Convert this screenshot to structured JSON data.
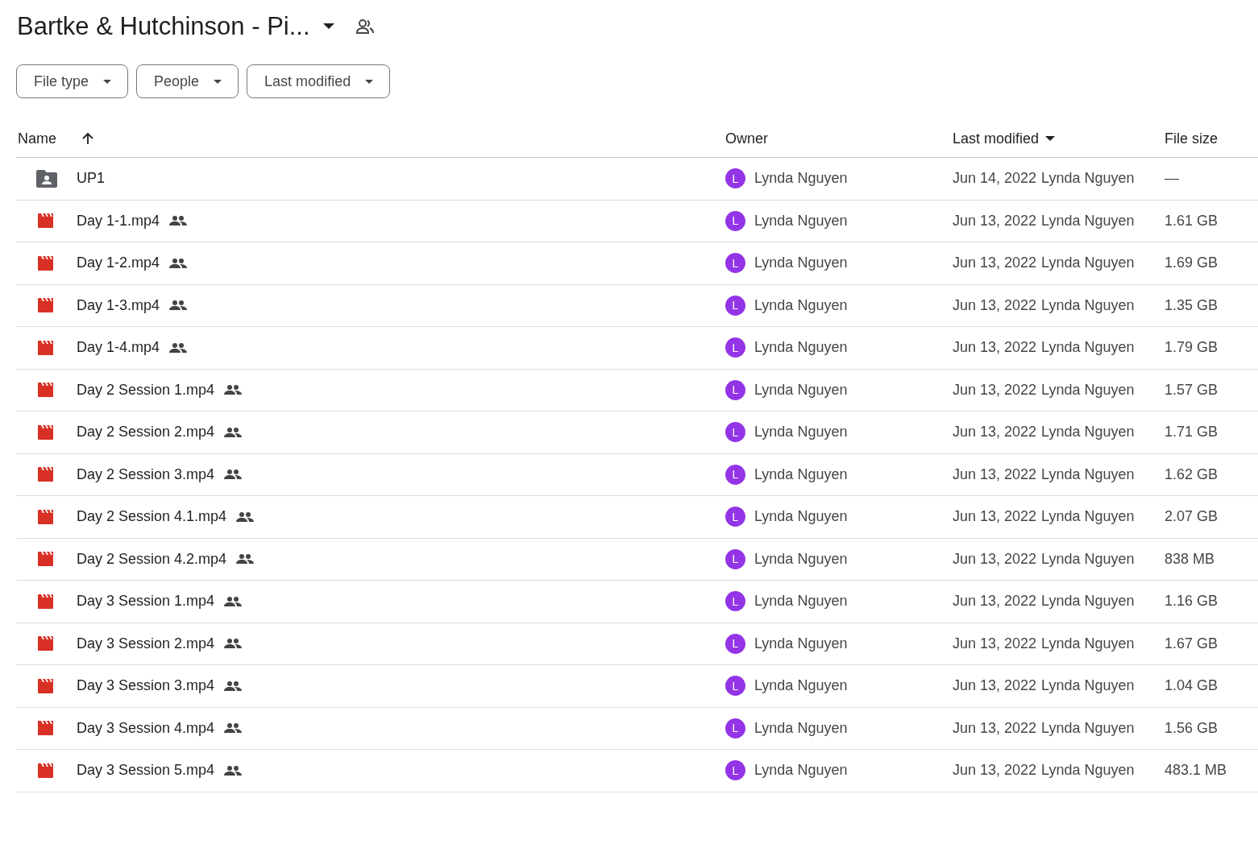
{
  "title": "Bartke & Hutchinson - Pi...",
  "filters": [
    {
      "label": "File type"
    },
    {
      "label": "People"
    },
    {
      "label": "Last modified"
    }
  ],
  "columns": {
    "name": "Name",
    "owner": "Owner",
    "modified": "Last modified",
    "size": "File size"
  },
  "rows": [
    {
      "kind": "folder",
      "name": "UP1",
      "shared": false,
      "avatar": "L",
      "owner": "Lynda Nguyen",
      "date": "Jun 14, 2022",
      "modified_by": "Lynda Nguyen",
      "size": "—"
    },
    {
      "kind": "video",
      "name": "Day 1-1.mp4",
      "shared": true,
      "avatar": "L",
      "owner": "Lynda Nguyen",
      "date": "Jun 13, 2022",
      "modified_by": "Lynda Nguyen",
      "size": "1.61 GB"
    },
    {
      "kind": "video",
      "name": "Day 1-2.mp4",
      "shared": true,
      "avatar": "L",
      "owner": "Lynda Nguyen",
      "date": "Jun 13, 2022",
      "modified_by": "Lynda Nguyen",
      "size": "1.69 GB"
    },
    {
      "kind": "video",
      "name": "Day 1-3.mp4",
      "shared": true,
      "avatar": "L",
      "owner": "Lynda Nguyen",
      "date": "Jun 13, 2022",
      "modified_by": "Lynda Nguyen",
      "size": "1.35 GB"
    },
    {
      "kind": "video",
      "name": "Day 1-4.mp4",
      "shared": true,
      "avatar": "L",
      "owner": "Lynda Nguyen",
      "date": "Jun 13, 2022",
      "modified_by": "Lynda Nguyen",
      "size": "1.79 GB"
    },
    {
      "kind": "video",
      "name": "Day 2 Session 1.mp4",
      "shared": true,
      "avatar": "L",
      "owner": "Lynda Nguyen",
      "date": "Jun 13, 2022",
      "modified_by": "Lynda Nguyen",
      "size": "1.57 GB"
    },
    {
      "kind": "video",
      "name": "Day 2 Session 2.mp4",
      "shared": true,
      "avatar": "L",
      "owner": "Lynda Nguyen",
      "date": "Jun 13, 2022",
      "modified_by": "Lynda Nguyen",
      "size": "1.71 GB"
    },
    {
      "kind": "video",
      "name": "Day 2 Session 3.mp4",
      "shared": true,
      "avatar": "L",
      "owner": "Lynda Nguyen",
      "date": "Jun 13, 2022",
      "modified_by": "Lynda Nguyen",
      "size": "1.62 GB"
    },
    {
      "kind": "video",
      "name": "Day 2 Session 4.1.mp4",
      "shared": true,
      "avatar": "L",
      "owner": "Lynda Nguyen",
      "date": "Jun 13, 2022",
      "modified_by": "Lynda Nguyen",
      "size": "2.07 GB"
    },
    {
      "kind": "video",
      "name": "Day 2 Session 4.2.mp4",
      "shared": true,
      "avatar": "L",
      "owner": "Lynda Nguyen",
      "date": "Jun 13, 2022",
      "modified_by": "Lynda Nguyen",
      "size": "838 MB"
    },
    {
      "kind": "video",
      "name": "Day 3 Session 1.mp4",
      "shared": true,
      "avatar": "L",
      "owner": "Lynda Nguyen",
      "date": "Jun 13, 2022",
      "modified_by": "Lynda Nguyen",
      "size": "1.16 GB"
    },
    {
      "kind": "video",
      "name": "Day 3 Session 2.mp4",
      "shared": true,
      "avatar": "L",
      "owner": "Lynda Nguyen",
      "date": "Jun 13, 2022",
      "modified_by": "Lynda Nguyen",
      "size": "1.67 GB"
    },
    {
      "kind": "video",
      "name": "Day 3 Session 3.mp4",
      "shared": true,
      "avatar": "L",
      "owner": "Lynda Nguyen",
      "date": "Jun 13, 2022",
      "modified_by": "Lynda Nguyen",
      "size": "1.04 GB"
    },
    {
      "kind": "video",
      "name": "Day 3 Session 4.mp4",
      "shared": true,
      "avatar": "L",
      "owner": "Lynda Nguyen",
      "date": "Jun 13, 2022",
      "modified_by": "Lynda Nguyen",
      "size": "1.56 GB"
    },
    {
      "kind": "video",
      "name": "Day 3 Session 5.mp4",
      "shared": true,
      "avatar": "L",
      "owner": "Lynda Nguyen",
      "date": "Jun 13, 2022",
      "modified_by": "Lynda Nguyen",
      "size": "483.1 MB"
    }
  ]
}
